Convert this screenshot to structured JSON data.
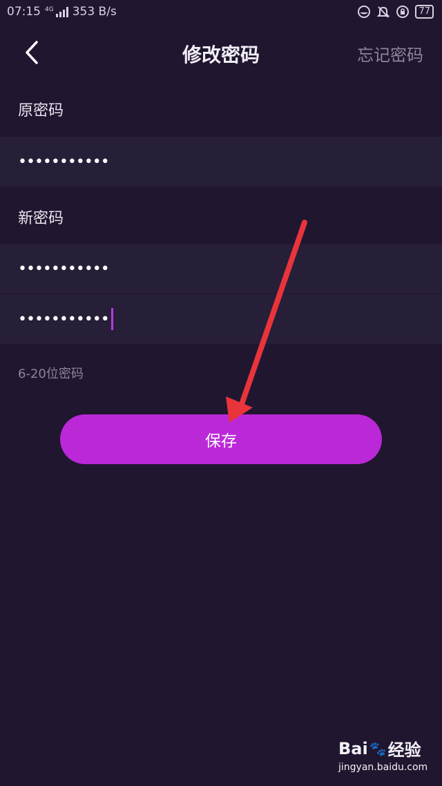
{
  "status": {
    "time": "07:15",
    "network_type": "4G",
    "speed": "353 B/s",
    "battery": "77"
  },
  "nav": {
    "title": "修改密码",
    "forgot_link": "忘记密码"
  },
  "form": {
    "old_label": "原密码",
    "old_value": "•••••••••••",
    "new_label": "新密码",
    "new_value": "•••••••••••",
    "confirm_value": "•••••••••••",
    "hint": "6-20位密码"
  },
  "actions": {
    "save_label": "保存"
  },
  "watermark": {
    "brand": "Bai",
    "brand_suffix": "经验",
    "url": "jingyan.baidu.com"
  },
  "colors": {
    "background": "#201630",
    "field_background": "#271e38",
    "accent": "#bb28d8",
    "annotation_arrow": "#e8343a"
  }
}
